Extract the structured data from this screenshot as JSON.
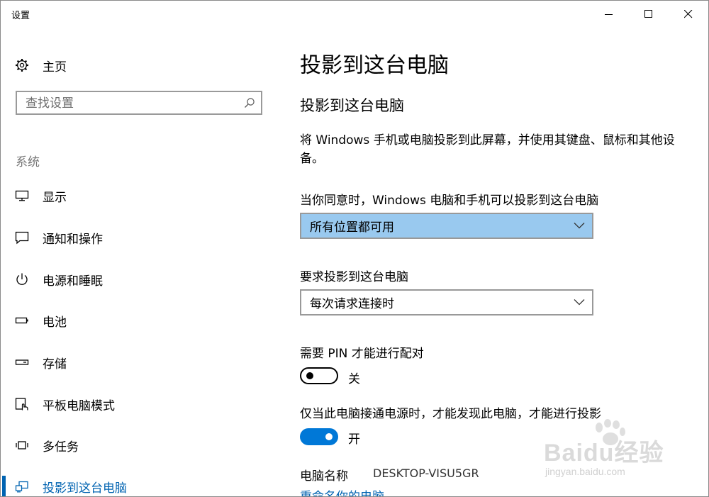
{
  "window": {
    "title": "设置"
  },
  "sidebar": {
    "home_label": "主页",
    "search_placeholder": "查找设置",
    "section_label": "系统",
    "items": [
      {
        "label": "显示",
        "icon": "monitor-icon"
      },
      {
        "label": "通知和操作",
        "icon": "notification-icon"
      },
      {
        "label": "电源和睡眠",
        "icon": "power-icon"
      },
      {
        "label": "电池",
        "icon": "battery-icon"
      },
      {
        "label": "存储",
        "icon": "storage-icon"
      },
      {
        "label": "平板电脑模式",
        "icon": "tablet-mode-icon"
      },
      {
        "label": "多任务",
        "icon": "multitasking-icon"
      },
      {
        "label": "投影到这台电脑",
        "icon": "project-icon",
        "active": true
      }
    ],
    "accent_color": "#0063b1"
  },
  "main": {
    "page_title": "投影到这台电脑",
    "section_title": "投影到这台电脑",
    "description": "将 Windows 手机或电脑投影到此屏幕，并使用其键盘、鼠标和其他设备。",
    "availability_label": "当你同意时，Windows 电脑和手机可以投影到这台电脑",
    "availability_value": "所有位置都可用",
    "request_label": "要求投影到这台电脑",
    "request_value": "每次请求连接时",
    "pin_label": "需要 PIN 才能进行配对",
    "pin_state": "关",
    "pin_on": false,
    "power_label": "仅当此电脑接通电源时，才能发现此电脑，才能进行投影",
    "power_state": "开",
    "power_on": true,
    "pc_name_label": "电脑名称",
    "pc_name_value": "DESKTOP-VISU5GR",
    "rename_link": "重命名你的电脑",
    "toggle_on_color": "#0078d7",
    "dropdown_highlight_color": "#99c9ef"
  },
  "watermark": {
    "text": "Baidu经验",
    "sub": "jingyan.baidu.com"
  }
}
